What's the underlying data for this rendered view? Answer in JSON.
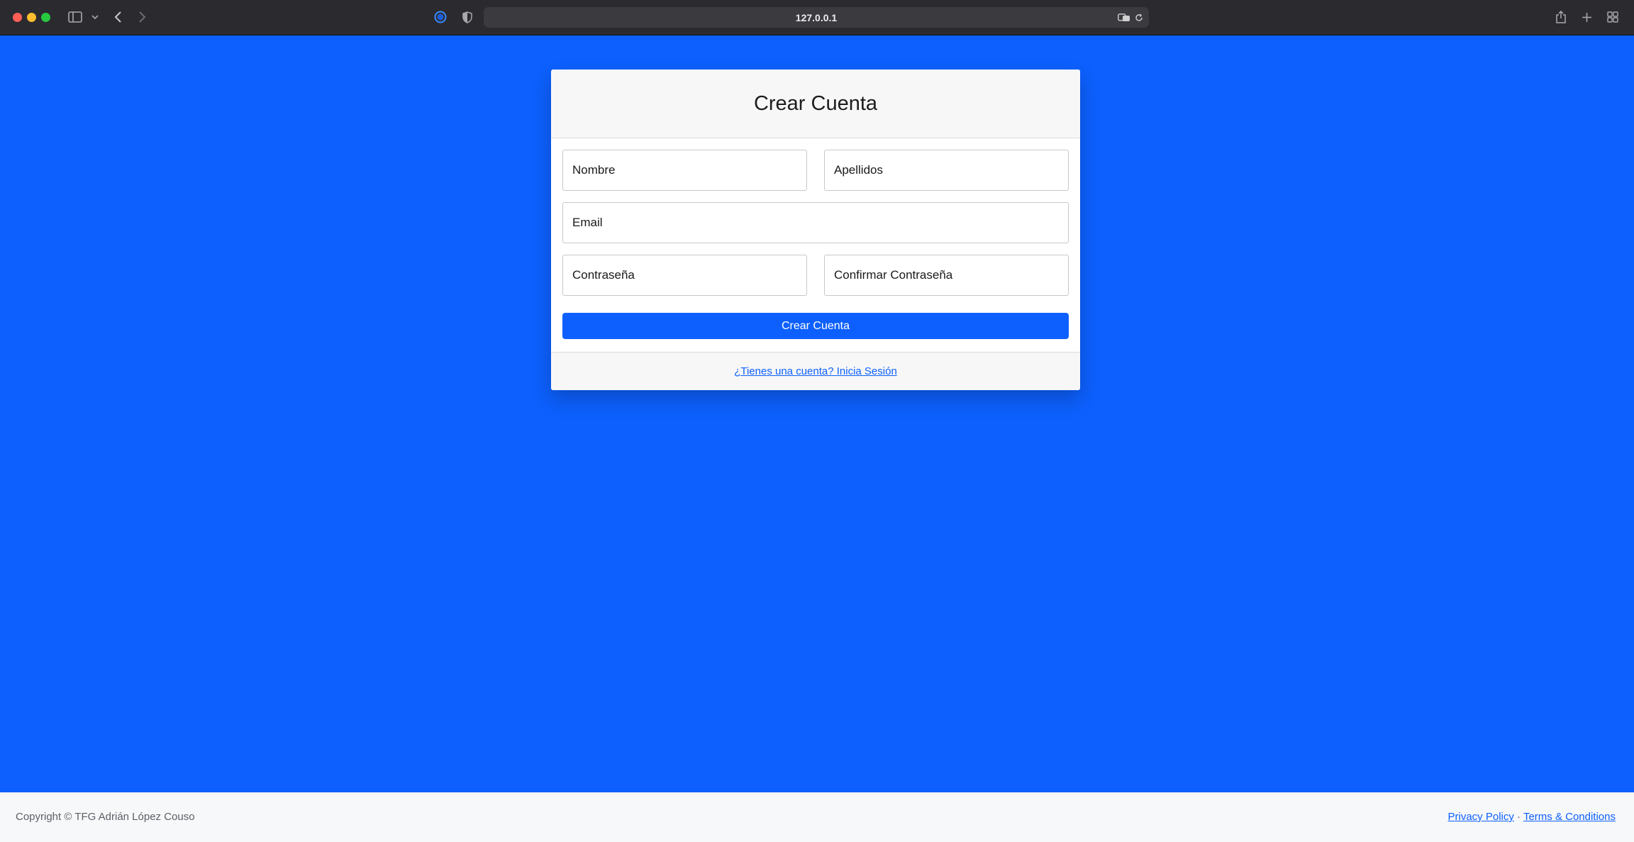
{
  "browser": {
    "url": "127.0.0.1",
    "icons": [
      "sidebar-icon",
      "chevron-down-icon",
      "back-icon",
      "forward-icon",
      "privacy-report-icon",
      "shield-icon",
      "translate-icon",
      "reload-icon",
      "share-icon",
      "new-tab-icon",
      "tab-overview-icon"
    ]
  },
  "signup": {
    "title": "Crear Cuenta",
    "fields": {
      "nombre": "Nombre",
      "apellidos": "Apellidos",
      "email": "Email",
      "password": "Contraseña",
      "confirm_password": "Confirmar Contraseña"
    },
    "submit_label": "Crear Cuenta",
    "login_link": "¿Tienes una cuenta? Inicia Sesión"
  },
  "footer": {
    "copyright": "Copyright © TFG Adrián López Couso",
    "privacy": "Privacy Policy",
    "separator": "·",
    "terms": "Terms & Conditions"
  },
  "colors": {
    "accent": "#0d60fd",
    "background": "#0d60fd",
    "chrome": "#2b2a2f"
  }
}
